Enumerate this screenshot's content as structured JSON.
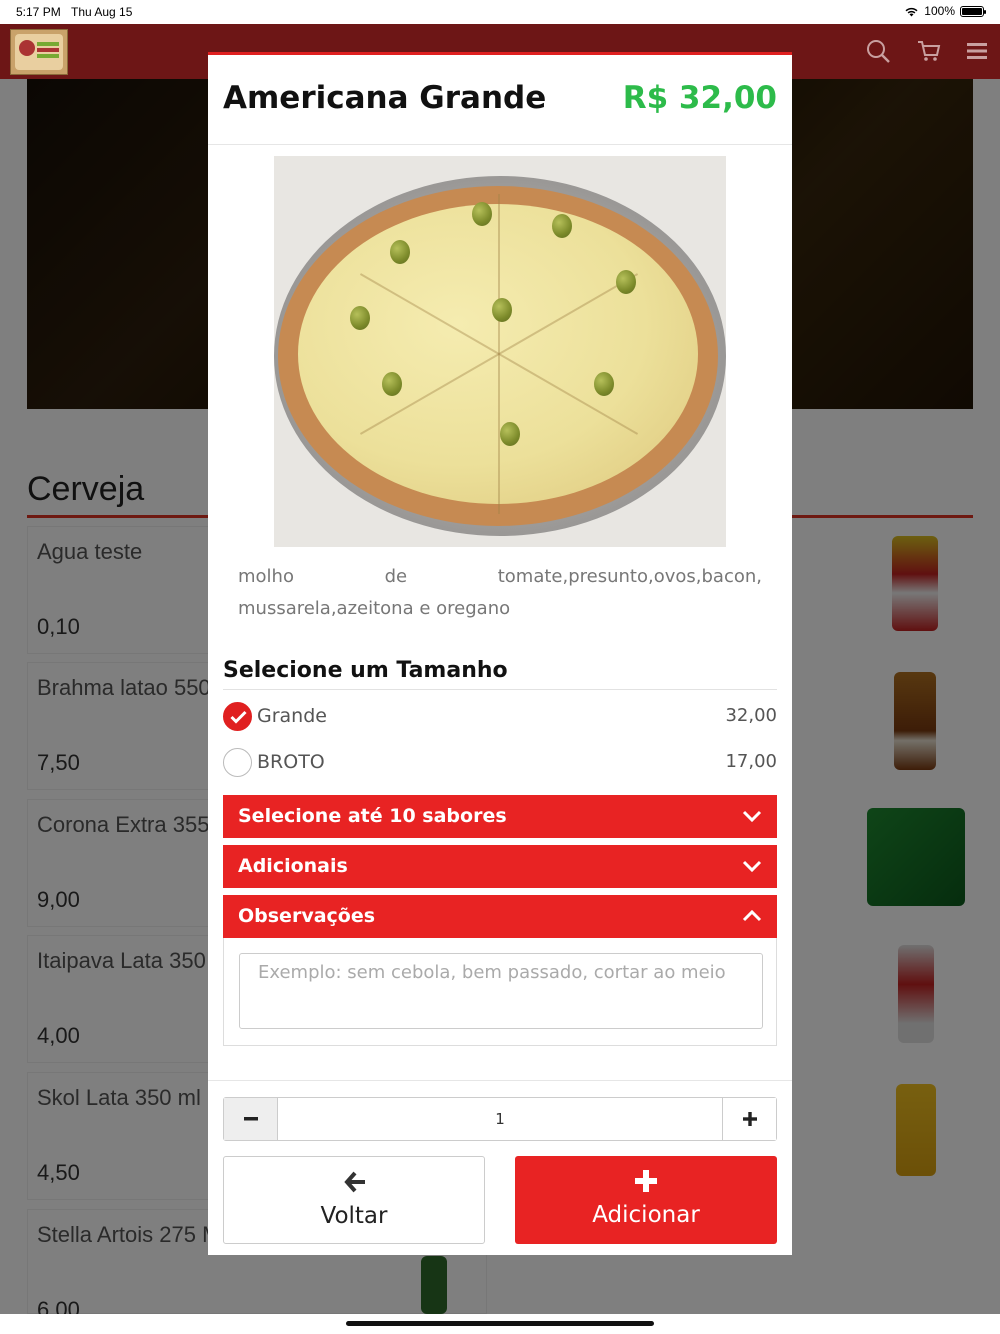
{
  "status_bar": {
    "time": "5:17 PM",
    "date": "Thu Aug 15",
    "battery": "100%"
  },
  "header": {
    "icons": [
      "search-icon",
      "cart-icon",
      "menu-icon"
    ]
  },
  "background": {
    "section_title": "Cerveja",
    "items": [
      {
        "name": "Agua teste",
        "price": "0,10"
      },
      {
        "name": "Brahma latao 550 m",
        "price": "7,50"
      },
      {
        "name": "Corona Extra 355 M",
        "price": "9,00"
      },
      {
        "name": "Itaipava Lata 350 m",
        "price": "4,00"
      },
      {
        "name": "Skol Lata 350 ml",
        "price": "4,50"
      },
      {
        "name": "Stella Artois 275 M",
        "price": "6,00"
      }
    ]
  },
  "modal": {
    "title": "Americana Grande",
    "price": "R$ 32,00",
    "description": "molho de tomate,presunto,ovos,bacon, mussarela,azeitona e oregano",
    "size_section": "Selecione um Tamanho",
    "sizes": [
      {
        "label": "Grande",
        "price": "32,00",
        "selected": true
      },
      {
        "label": "BROTO",
        "price": "17,00",
        "selected": false
      }
    ],
    "flavors_label": "Selecione até 10 sabores",
    "extras_label": "Adicionais",
    "notes_label": "Observações",
    "notes_placeholder": "Exemplo: sem cebola, bem passado, cortar ao meio",
    "quantity": "1",
    "back_label": "Voltar",
    "add_label": "Adicionar"
  },
  "colors": {
    "accent": "#e82323",
    "price_green": "#2dbb4a",
    "header": "#6d1616"
  }
}
